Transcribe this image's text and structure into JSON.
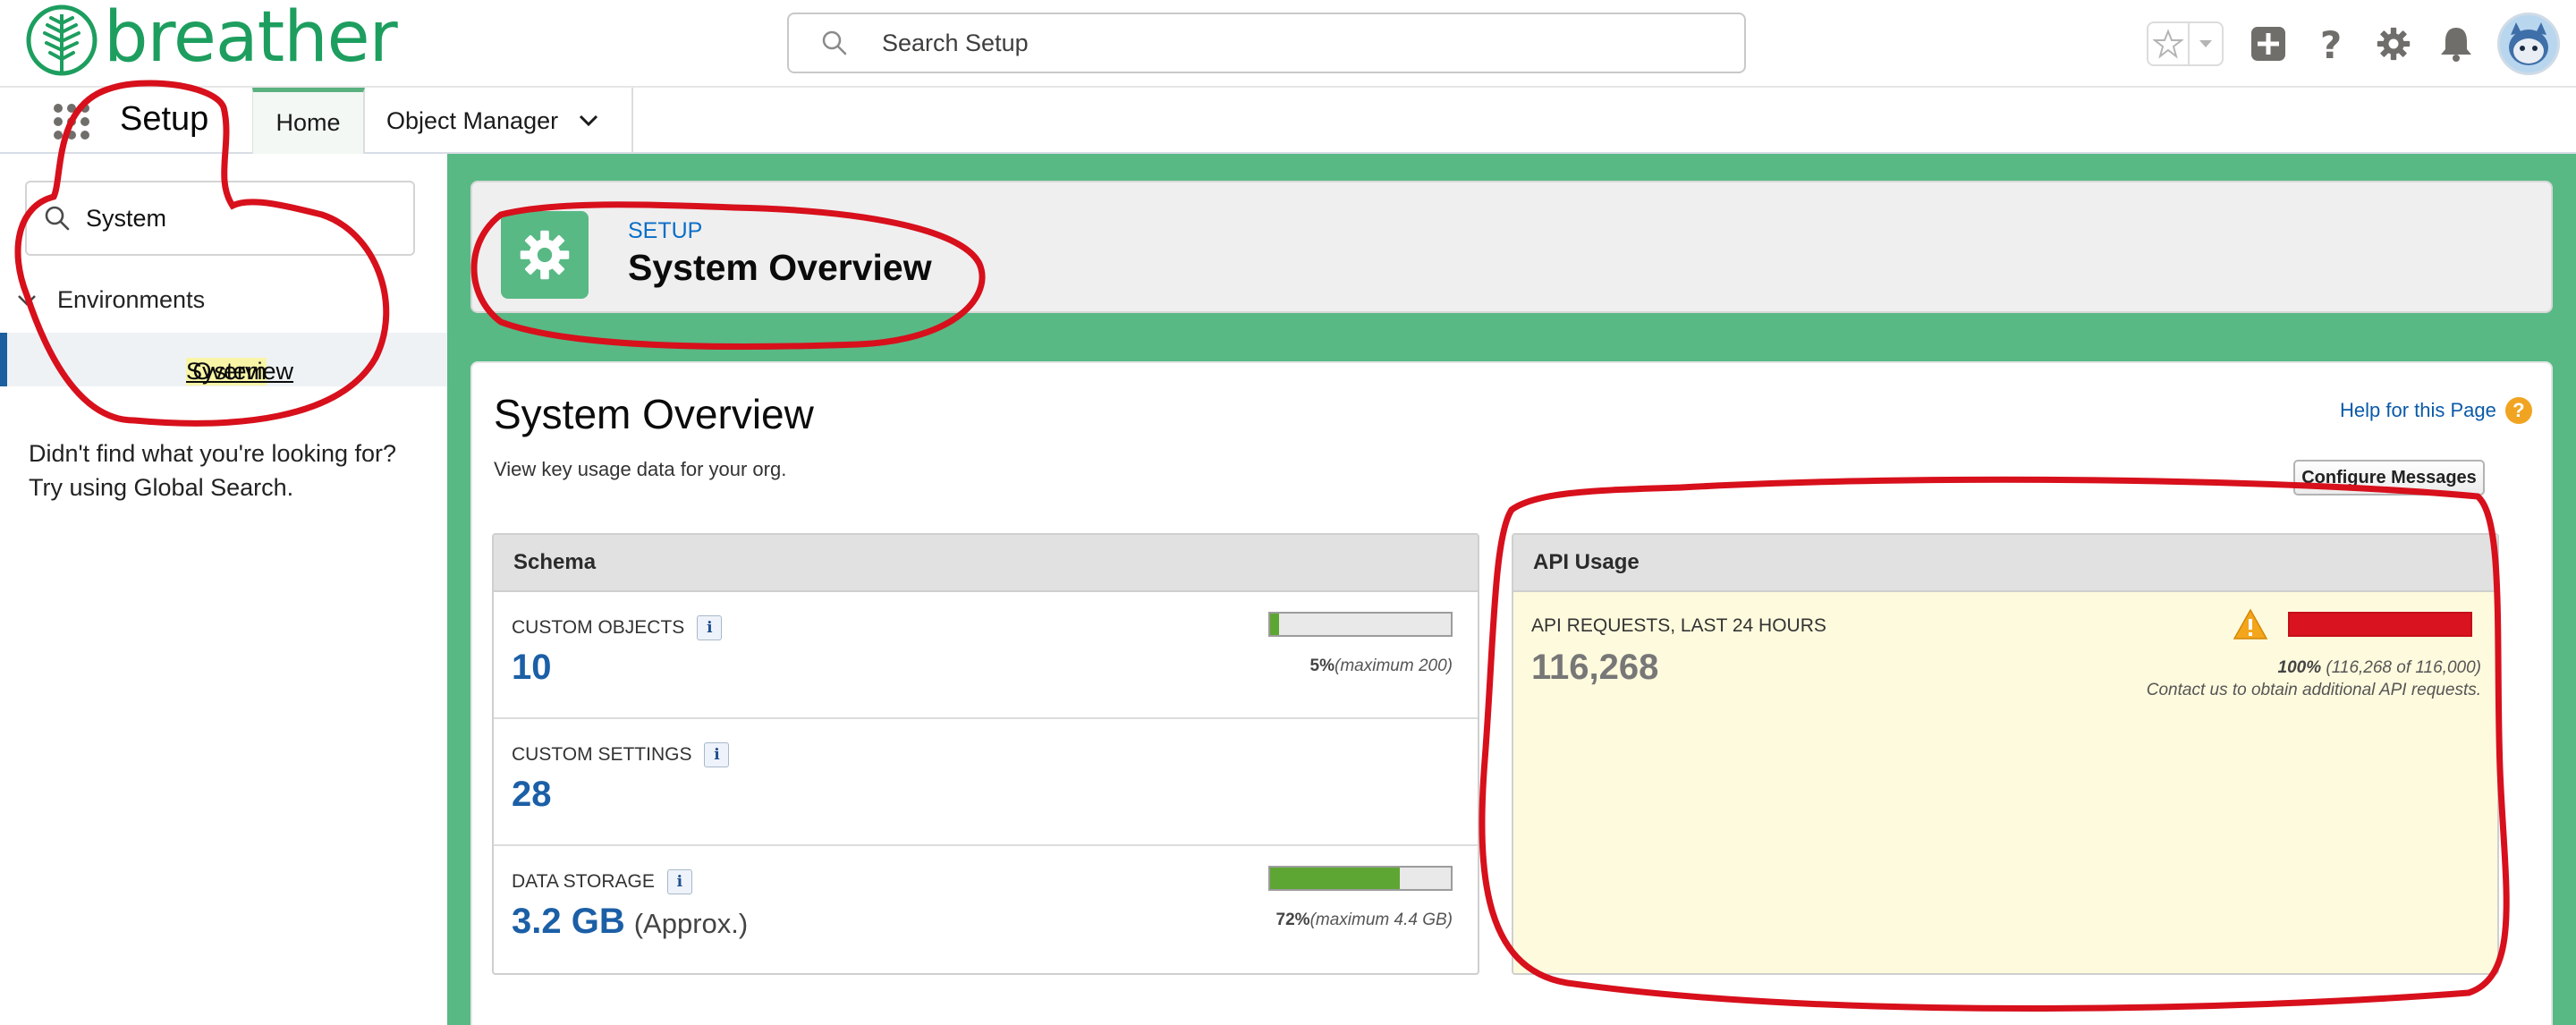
{
  "header": {
    "logo_text": "breather",
    "search_placeholder": "Search Setup",
    "icons": [
      "favorites-star-icon",
      "favorites-dropdown-icon",
      "global-actions-plus-icon",
      "help-question-icon",
      "setup-gear-icon",
      "notifications-bell-icon",
      "user-avatar"
    ]
  },
  "nav": {
    "app_launcher_icon": "app-launcher-waffle-icon",
    "app_name": "Setup",
    "tabs": [
      {
        "label": "Home"
      },
      {
        "label": "Object Manager"
      }
    ]
  },
  "sidebar": {
    "quickfind_value": "System",
    "group": "Environments",
    "item_highlight": "System",
    "item_rest": " Overview",
    "hint_line1": "Didn't find what you're looking for?",
    "hint_line2": "Try using Global Search."
  },
  "page_header": {
    "breadcrumb": "SETUP",
    "title": "System Overview"
  },
  "content": {
    "title": "System Overview",
    "description": "View key usage data for your org.",
    "help_link": "Help for this Page",
    "configure_button": "Configure Messages"
  },
  "schema": {
    "title": "Schema",
    "rows": [
      {
        "label": "CUSTOM OBJECTS",
        "value": "10",
        "percent_label": "5%",
        "max_label": "(maximum 200)",
        "fill": 0.05
      },
      {
        "label": "CUSTOM SETTINGS",
        "value": "28"
      },
      {
        "label": "DATA STORAGE",
        "value": "3.2 GB",
        "suffix": "(Approx.)",
        "percent_label": "72%",
        "max_label": "(maximum 4.4 GB)",
        "fill": 0.72
      }
    ]
  },
  "api_usage": {
    "title": "API Usage",
    "label": "API REQUESTS, LAST 24 HOURS",
    "value": "116,268",
    "percent_label": "100%",
    "detail": "(116,268 of 116,000)",
    "contact": "Contact us to obtain additional API requests.",
    "fill": 1.0
  },
  "colors": {
    "brand_green": "#1d9e5f",
    "main_background": "#58b985",
    "value_blue": "#1b5fa6",
    "bar_green": "#5ea633",
    "api_bar_red": "#d9131f",
    "api_background": "#fefadd",
    "annotation_red": "#d7101c"
  }
}
